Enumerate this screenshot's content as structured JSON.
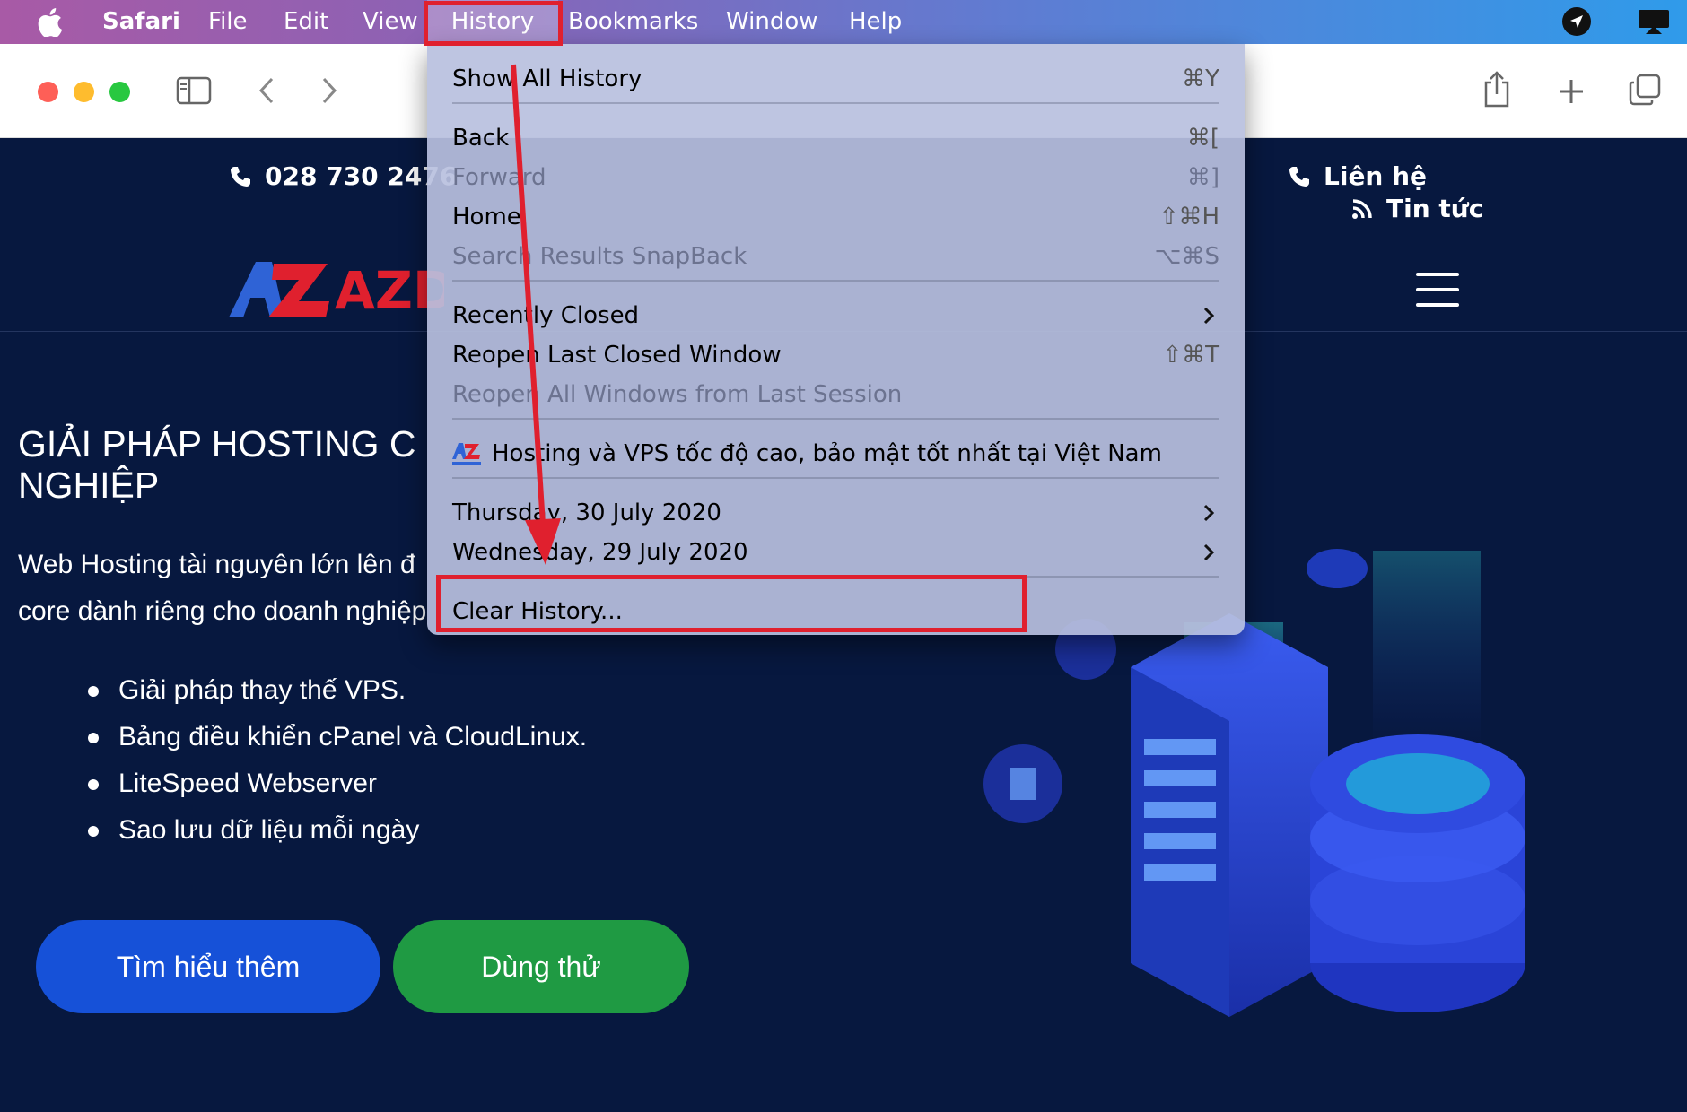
{
  "menubar": {
    "app_name": "Safari",
    "items": [
      "File",
      "Edit",
      "View",
      "History",
      "Bookmarks",
      "Window",
      "Help"
    ],
    "highlighted": "History",
    "icons": [
      "apple-icon",
      "location-arrow-icon",
      "display-icon"
    ]
  },
  "toolbar": {
    "icons": [
      "sidebar-icon",
      "back-icon",
      "forward-icon",
      "share-icon",
      "new-tab-icon",
      "tabs-overview-icon"
    ]
  },
  "site": {
    "phone": "028 730 2476",
    "contact_label": "Liên hệ",
    "news_label": "Tin tức",
    "logo_text": "AZDI",
    "hero_title": "GIẢI PHÁP HOSTING C NGHIỆP",
    "hero_desc_line1": "Web Hosting tài nguyên lớn lên đ",
    "hero_desc_line2": "core dành riêng cho doanh nghiệp",
    "features": [
      "Giải pháp thay thế VPS.",
      "Bảng điều khiển cPanel và CloudLinux.",
      "LiteSpeed Webserver",
      "Sao lưu dữ liệu mỗi ngày"
    ],
    "btn_learn_more": "Tìm hiểu thêm",
    "btn_try": "Dùng thử"
  },
  "history_menu": {
    "show_all": {
      "label": "Show All History",
      "shortcut": "⌘Y"
    },
    "back": {
      "label": "Back",
      "shortcut": "⌘["
    },
    "forward": {
      "label": "Forward",
      "shortcut": "⌘]"
    },
    "home": {
      "label": "Home",
      "shortcut": "⇧⌘H"
    },
    "snapback": {
      "label": "Search Results SnapBack",
      "shortcut": "⌥⌘S"
    },
    "recently_closed": {
      "label": "Recently Closed"
    },
    "reopen_last": {
      "label": "Reopen Last Closed Window",
      "shortcut": "⇧⌘T"
    },
    "reopen_all": {
      "label": "Reopen All Windows from Last Session"
    },
    "recent_page": {
      "label": "Hosting và VPS tốc độ cao, bảo mật tốt nhất tại Việt Nam"
    },
    "day1": {
      "label": "Thursday, 30 July 2020"
    },
    "day2": {
      "label": "Wednesday, 29 July 2020"
    },
    "clear": {
      "label": "Clear History..."
    }
  },
  "colors": {
    "annotation_red": "#e0202e",
    "site_bg": "#07183f",
    "btn_blue": "#1651d8",
    "btn_green": "#1f9a43"
  }
}
